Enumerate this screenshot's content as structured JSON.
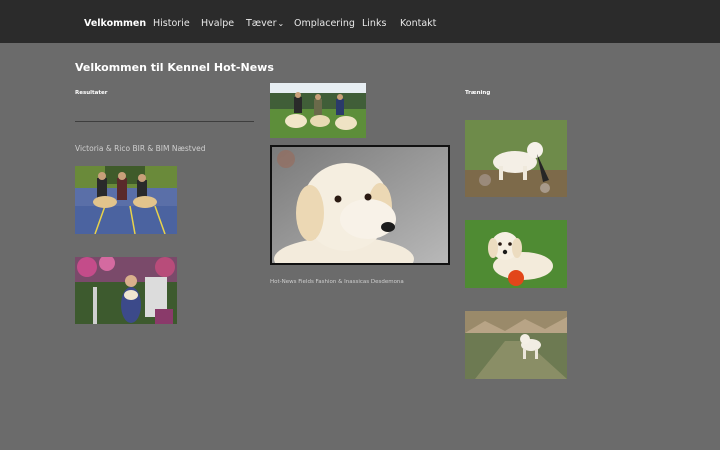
{
  "nav": {
    "items": [
      {
        "label": "Velkommen",
        "active": true
      },
      {
        "label": "Historie",
        "active": false
      },
      {
        "label": "Hvalpe",
        "active": false
      },
      {
        "label": "Tæver",
        "active": false,
        "has_dropdown": true
      },
      {
        "label": "Omplacering",
        "active": false
      },
      {
        "label": "Links",
        "active": false
      },
      {
        "label": "Kontakt",
        "active": false
      }
    ],
    "dropdown_icon": "chevron-down-icon"
  },
  "main": {
    "title": "Velkommen til Kennel Hot-News",
    "left": {
      "heading": "Resultater",
      "caption": "Victoria & Rico BIR & BIM Næstved"
    },
    "center": {
      "caption": "Hot-News Fields Fashion & Inassicas Desdemona"
    },
    "right": {
      "heading": "Træning"
    }
  },
  "colors": {
    "background": "#6b6b6b",
    "nav_background": "#2b2b2b",
    "text": "#ffffff"
  }
}
